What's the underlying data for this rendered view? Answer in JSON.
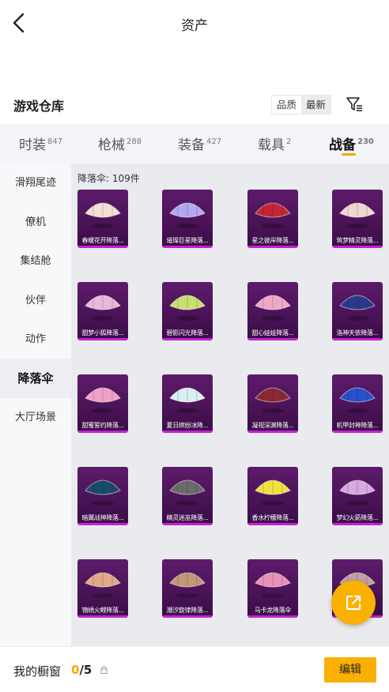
{
  "header": {
    "title": "资产"
  },
  "section": {
    "title": "游戏仓库"
  },
  "sort": {
    "quality": "品质",
    "latest": "最新"
  },
  "tabs": [
    {
      "label": "时装",
      "count": "847"
    },
    {
      "label": "枪械",
      "count": "288"
    },
    {
      "label": "装备",
      "count": "427"
    },
    {
      "label": "载具",
      "count": "2"
    },
    {
      "label": "战备",
      "count": "230"
    }
  ],
  "sidebar": {
    "items": [
      "滑翔尾迹",
      "僚机",
      "集结舱",
      "伙伴",
      "动作",
      "降落伞",
      "大厅场景"
    ]
  },
  "grid": {
    "label": "降落伞: 109件",
    "items": [
      {
        "name": "春暖花开降落...",
        "color": "#f2e0d2"
      },
      {
        "name": "璀璨巨星降落...",
        "color": "#b3a8f0"
      },
      {
        "name": "星之彼岸降落...",
        "color": "#c42535"
      },
      {
        "name": "筑梦精灵降落...",
        "color": "#f0d8d0"
      },
      {
        "name": "甜梦小狐降落...",
        "color": "#e8b8d8"
      },
      {
        "name": "碧影闪光降落...",
        "color": "#c8e070"
      },
      {
        "name": "甜心娃娃降落...",
        "color": "#f0a8c8"
      },
      {
        "name": "洛神天依降落...",
        "color": "#2a3a8a"
      },
      {
        "name": "甜蜜誓约降落...",
        "color": "#f0a0c8"
      },
      {
        "name": "夏日缤纷冰降...",
        "color": "#d8f0f0"
      },
      {
        "name": "凝视深渊降落...",
        "color": "#8a2838"
      },
      {
        "name": "机甲封神降落...",
        "color": "#2850c8"
      },
      {
        "name": "暗翼战神降落...",
        "color": "#1a4a6a"
      },
      {
        "name": "精灵迷巫降落...",
        "color": "#6a6a6a"
      },
      {
        "name": "香水柠檬降落...",
        "color": "#f0e040"
      },
      {
        "name": "梦幻火箭降落...",
        "color": "#d8a8e0"
      },
      {
        "name": "锦绣火鲤降落...",
        "color": "#e0a888"
      },
      {
        "name": "潮汐旋律降落...",
        "color": "#c09878"
      },
      {
        "name": "马卡龙降落伞",
        "color": "#e890b8"
      },
      {
        "name": "",
        "color": "#c0a0a0"
      }
    ]
  },
  "footer": {
    "label": "我的橱窗",
    "current": "0",
    "total": "/5",
    "edit": "编辑"
  },
  "colors": {
    "accent": "#f9b000",
    "item_bg": "#4a1356",
    "rarity": "#c71fd6"
  }
}
